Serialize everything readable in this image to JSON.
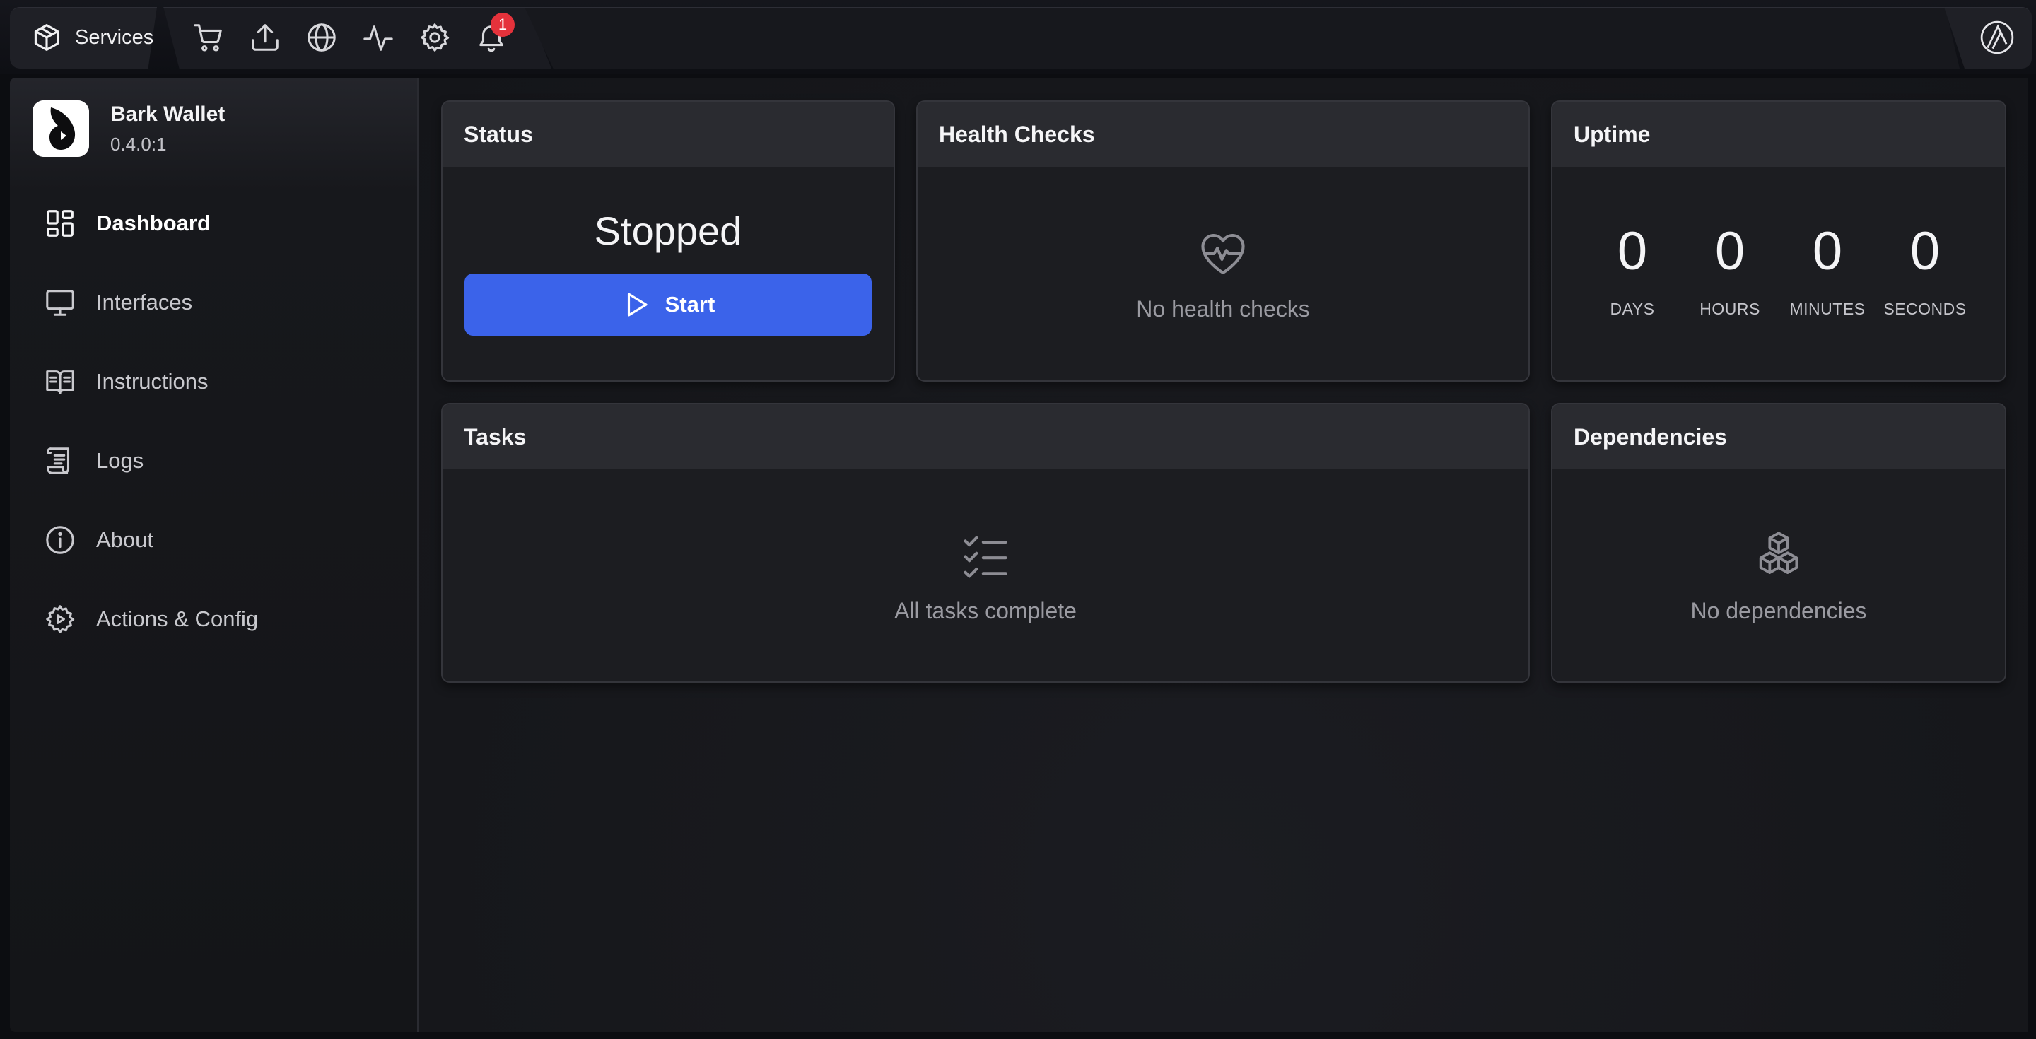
{
  "topbar": {
    "services_label": "Services",
    "icons": [
      "cart-icon",
      "upload-icon",
      "globe-icon",
      "activity-icon",
      "gear-icon",
      "bell-icon"
    ],
    "notification_count": "1"
  },
  "sidebar": {
    "app_name": "Bark Wallet",
    "app_version": "0.4.0:1",
    "items": [
      {
        "label": "Dashboard",
        "icon": "dashboard-icon",
        "active": true
      },
      {
        "label": "Interfaces",
        "icon": "monitor-icon"
      },
      {
        "label": "Instructions",
        "icon": "book-icon"
      },
      {
        "label": "Logs",
        "icon": "scroll-icon"
      },
      {
        "label": "About",
        "icon": "info-icon"
      },
      {
        "label": "Actions & Config",
        "icon": "gear-play-icon"
      }
    ]
  },
  "cards": {
    "status": {
      "title": "Status",
      "value": "Stopped",
      "button_label": "Start"
    },
    "health": {
      "title": "Health Checks",
      "empty": "No health checks"
    },
    "uptime": {
      "title": "Uptime",
      "units": [
        {
          "value": "0",
          "label": "DAYS"
        },
        {
          "value": "0",
          "label": "HOURS"
        },
        {
          "value": "0",
          "label": "MINUTES"
        },
        {
          "value": "0",
          "label": "SECONDS"
        }
      ]
    },
    "tasks": {
      "title": "Tasks",
      "empty": "All tasks complete"
    },
    "dependencies": {
      "title": "Dependencies",
      "empty": "No dependencies"
    }
  },
  "colors": {
    "accent": "#3b63ea",
    "badge": "#e5323b",
    "card_bg": "#1c1d21",
    "card_header": "#2a2b30"
  }
}
